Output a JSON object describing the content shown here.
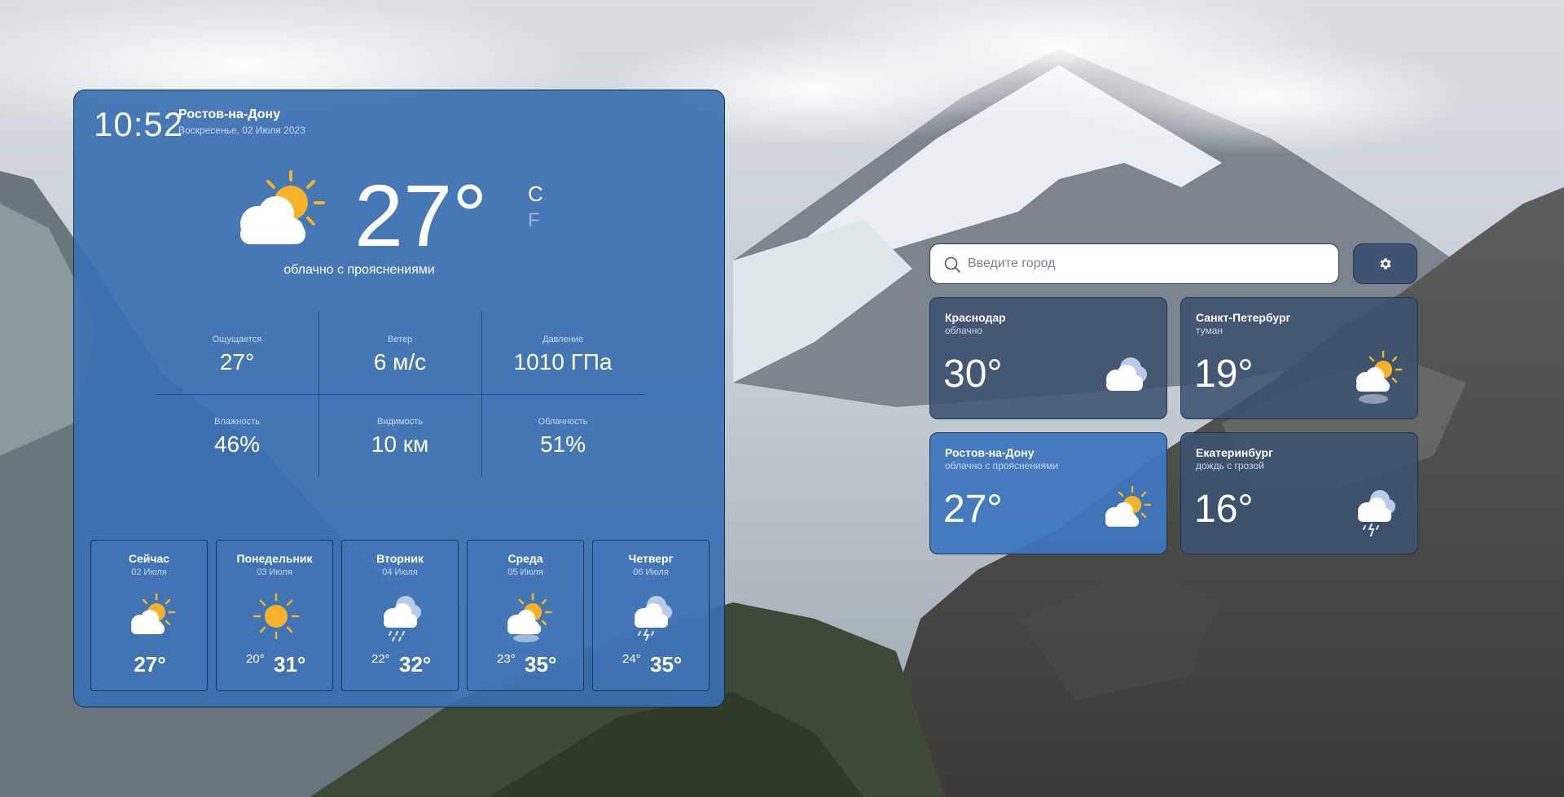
{
  "main": {
    "time": "10:52",
    "city": "Ростов-на-Дону",
    "date": "Воскресенье, 02 Июля 2023",
    "temperature": "27°",
    "unit_c": "C",
    "unit_f": "F",
    "description": "облачно с прояснениями",
    "icon": "partly-cloudy-icon",
    "stats": [
      {
        "label": "Ощущается",
        "value": "27°"
      },
      {
        "label": "Ветер",
        "value": "6 м/с"
      },
      {
        "label": "Давление",
        "value": "1010 ГПа"
      },
      {
        "label": "Влажность",
        "value": "46%"
      },
      {
        "label": "Видимость",
        "value": "10 км"
      },
      {
        "label": "Облачность",
        "value": "51%"
      }
    ],
    "forecast": [
      {
        "day": "Сейчас",
        "date": "02 Июля",
        "min": "",
        "max": "27°",
        "icon": "partly-cloudy-icon"
      },
      {
        "day": "Понедельник",
        "date": "03 Июля",
        "min": "20°",
        "max": "31°",
        "icon": "sun-icon"
      },
      {
        "day": "Вторник",
        "date": "04 Июля",
        "min": "22°",
        "max": "32°",
        "icon": "rain-cloud-icon"
      },
      {
        "day": "Среда",
        "date": "05 Июля",
        "min": "23°",
        "max": "35°",
        "icon": "sun-fog-icon"
      },
      {
        "day": "Четверг",
        "date": "06 Июля",
        "min": "24°",
        "max": "35°",
        "icon": "storm-cloud-icon"
      }
    ]
  },
  "search": {
    "placeholder": "Введите город"
  },
  "settings": {
    "icon": "gear-icon"
  },
  "cities": [
    {
      "name": "Краснодар",
      "description": "облачно",
      "temperature": "30°",
      "icon": "clouds-icon",
      "active": false
    },
    {
      "name": "Санкт-Петербург",
      "description": "туман",
      "temperature": "19°",
      "icon": "sun-fog-icon",
      "active": false
    },
    {
      "name": "Ростов-на-Дону",
      "description": "облачно с прояснениями",
      "temperature": "27°",
      "icon": "partly-cloudy-icon",
      "active": true
    },
    {
      "name": "Екатеринбург",
      "description": "дождь с грозой",
      "temperature": "16°",
      "icon": "storm-cloud-icon",
      "active": false
    }
  ],
  "colors": {
    "card_blue": "#3a70b2",
    "card_slate": "#3c5272",
    "sun": "#f7b22a",
    "cloud": "#ffffff"
  }
}
